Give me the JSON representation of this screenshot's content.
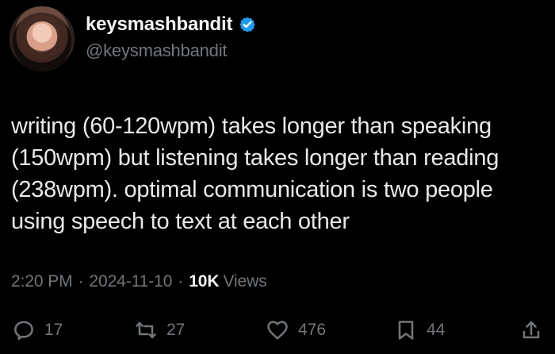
{
  "profile": {
    "display_name": "keysmashbandit",
    "handle": "@keysmashbandit",
    "avatar_icon": "user-avatar-icon",
    "verified_icon": "verified-badge-icon",
    "verified_color": "#1d9bf0"
  },
  "tweet": {
    "text": "writing (60-120wpm) takes longer than speaking (150wpm) but listening takes longer than reading (238wpm). optimal communication is two people using speech to text at each other",
    "time": "2:20 PM",
    "date": "2024-11-10",
    "separator": "·",
    "views_count": "10K",
    "views_label": "Views"
  },
  "actions": {
    "reply": {
      "icon": "reply-icon",
      "count": "17"
    },
    "repost": {
      "icon": "repost-icon",
      "count": "27"
    },
    "like": {
      "icon": "like-icon",
      "count": "476"
    },
    "bookmark": {
      "icon": "bookmark-icon",
      "count": "44"
    },
    "share": {
      "icon": "share-icon"
    }
  },
  "colors": {
    "background": "#000000",
    "primary_text": "#e7e9ea",
    "secondary_text": "#71767b",
    "accent_blue": "#1d9bf0"
  }
}
